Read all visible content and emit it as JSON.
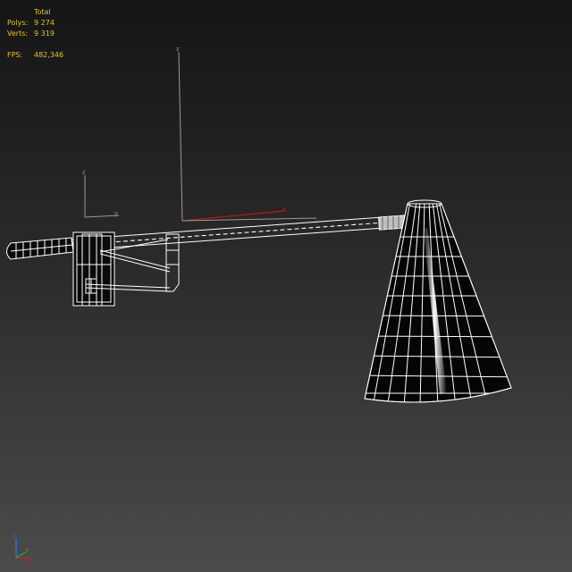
{
  "viewport": {
    "stats": {
      "header": "Total",
      "polys_label": "Polys:",
      "polys_value": "9 274",
      "verts_label": "Verts:",
      "verts_value": "9 319",
      "fps_label": "FPS:",
      "fps_value": "482,346"
    },
    "world_axis": {
      "z": "z",
      "x": "x",
      "y": "y"
    },
    "pivot_gizmo": {
      "z": "z",
      "y": "y"
    },
    "corner_axis": {
      "z": "z",
      "x": "x",
      "y": "y"
    },
    "colors": {
      "stats_text": "#e8c21a",
      "wire": "#ffffff",
      "shade_fill": "#050505",
      "axis_x": "#c01818",
      "axis_gray": "#9a9a9a",
      "corner_z": "#3a6ad0",
      "corner_x": "#d02020",
      "corner_y": "#30a030"
    }
  }
}
